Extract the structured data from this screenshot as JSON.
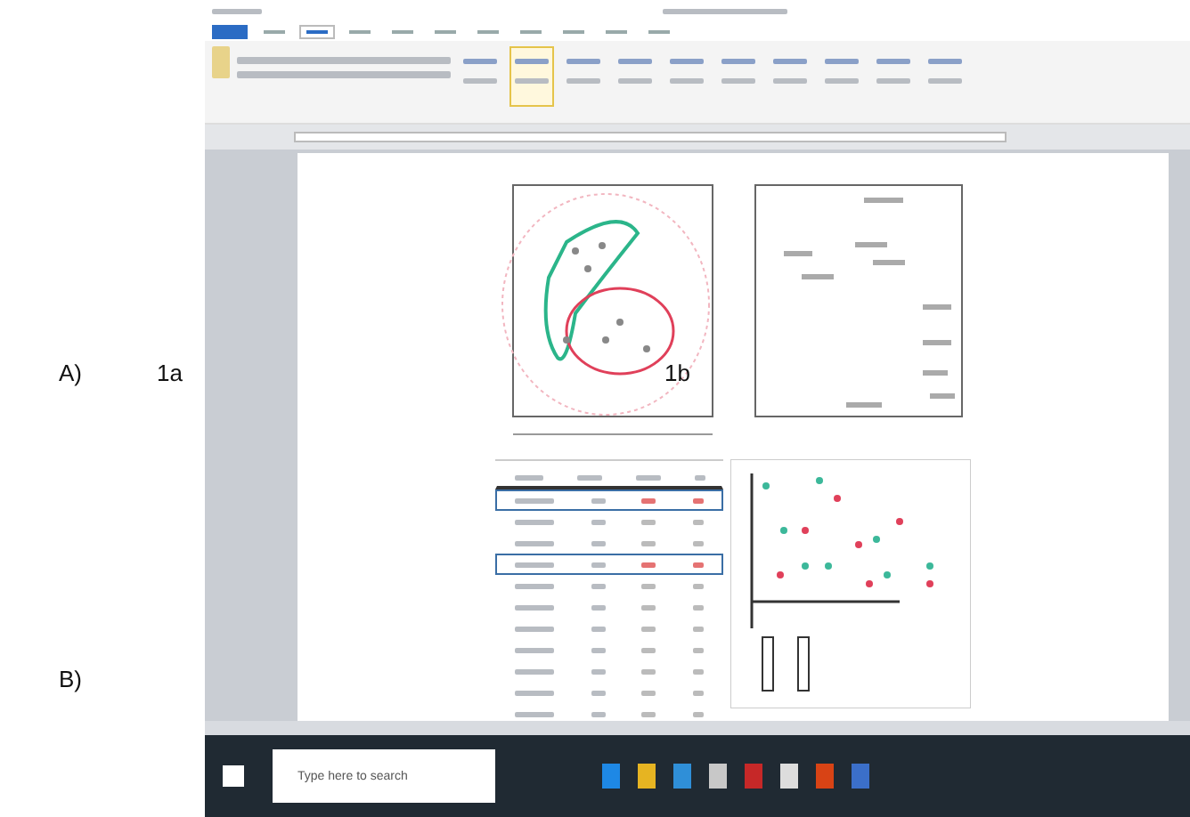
{
  "panel_labels": [
    "A)",
    "1a",
    "1b",
    "B)"
  ],
  "ribbon": {
    "tabs": [
      {
        "selected": false
      },
      {
        "selected": true
      },
      {
        "selected": false
      },
      {
        "selected": false
      },
      {
        "selected": false
      },
      {
        "selected": false
      },
      {
        "selected": false
      },
      {
        "selected": false
      },
      {
        "selected": false
      },
      {
        "selected": false
      }
    ],
    "styles": [
      {
        "selected": false
      },
      {
        "selected": true
      },
      {
        "selected": false
      },
      {
        "selected": false
      },
      {
        "selected": false
      },
      {
        "selected": false
      },
      {
        "selected": false
      },
      {
        "selected": false
      },
      {
        "selected": false
      },
      {
        "selected": false
      }
    ]
  },
  "table": {
    "rows": [
      {
        "highlighted": true
      },
      {
        "highlighted": false
      },
      {
        "highlighted": false
      },
      {
        "highlighted": true
      },
      {
        "highlighted": false
      },
      {
        "highlighted": false
      },
      {
        "highlighted": false
      },
      {
        "highlighted": false
      },
      {
        "highlighted": false
      },
      {
        "highlighted": false
      },
      {
        "highlighted": false
      }
    ]
  },
  "taskbar": {
    "search": {
      "placeholder": "Type here to search"
    },
    "apps": [
      {
        "color": "#1e88e5"
      },
      {
        "color": "#e6b422"
      },
      {
        "color": "#2f8fd8"
      },
      {
        "color": "#c8c8c8"
      },
      {
        "color": "#c62828"
      },
      {
        "color": "#dddddd"
      },
      {
        "color": "#d84315"
      },
      {
        "color": "#3b6fc9"
      }
    ]
  }
}
